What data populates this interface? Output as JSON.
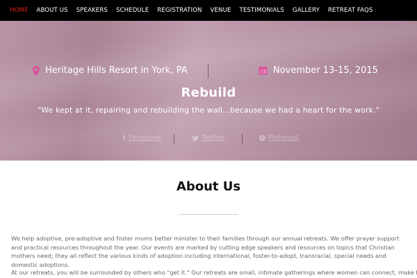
{
  "nav": {
    "items": [
      {
        "label": "HOME",
        "active": true
      },
      {
        "label": "ABOUT US"
      },
      {
        "label": "SPEAKERS"
      },
      {
        "label": "SCHEDULE"
      },
      {
        "label": "REGISTRATION"
      },
      {
        "label": "VENUE"
      },
      {
        "label": "TESTIMONIALS"
      },
      {
        "label": "GALLERY"
      },
      {
        "label": "RETREAT FAQS"
      }
    ],
    "active_color": "#e2231a"
  },
  "hero": {
    "location": "Heritage Hills Resort in York, PA",
    "location_icon": "map-pin-icon",
    "dates": "November 13-15, 2015",
    "dates_icon": "calendar-icon",
    "icon_color": "#d9509b",
    "title": "Rebuild",
    "quote": "\"We kept at it, repairing and rebuilding the wall...because we had a heart for the work.\"",
    "social": [
      {
        "label": "Facebook",
        "icon": "facebook-icon"
      },
      {
        "label": "Twitter",
        "icon": "twitter-icon"
      },
      {
        "label": "Pinterest",
        "icon": "pinterest-icon"
      }
    ]
  },
  "about": {
    "title": "About Us",
    "paragraph1": "We help adoptive, pre-adoptive and foster moms better minister to their families through our annual retreats.  We offer prayer support and practical resources throughout the year.  Our events are marked by cutting edge speakers and resources on topics that Christian mothers need; they all reflect the various kinds of adoption including international, foster-to-adopt, transracial, special needs and domestic adoptions.",
    "paragraph2": "At our retreats, you will be surrounded by others who \"get it.\"  Our retreats are small, intimate gatherings where women can connect, make life-"
  }
}
